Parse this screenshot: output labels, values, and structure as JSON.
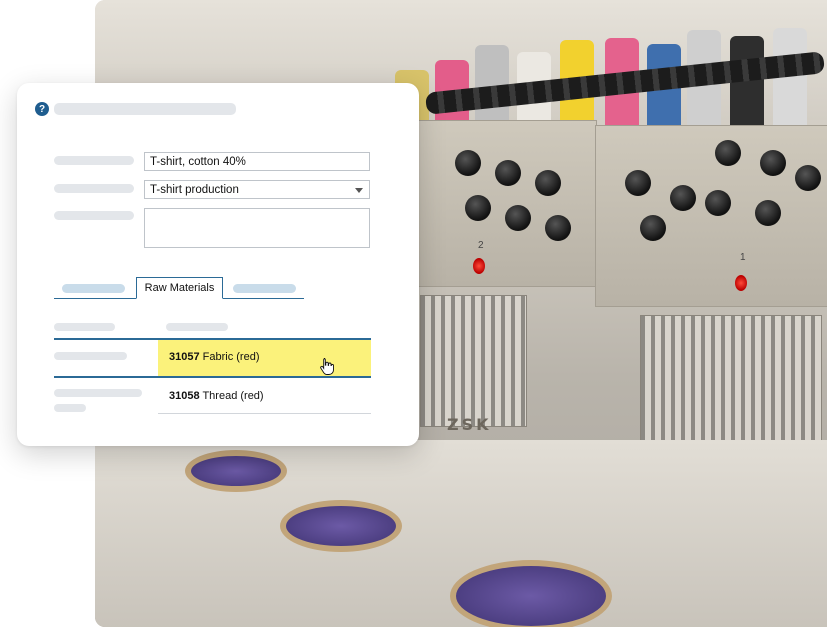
{
  "form": {
    "help_icon": "?",
    "name_value": "T-shirt, cotton 40%",
    "category_value": "T-shirt production",
    "notes_value": ""
  },
  "tabs": {
    "active_label": "Raw Materials"
  },
  "materials": [
    {
      "code": "31057",
      "name": "Fabric (red)",
      "highlighted": true
    },
    {
      "code": "31058",
      "name": "Thread (red)",
      "highlighted": false
    }
  ],
  "colors": {
    "accent": "#2b6a96",
    "highlight": "#fbf27b",
    "help_icon_bg": "#1f5d8f",
    "skeleton": "#e3e6ea"
  },
  "icons": [
    "help-icon",
    "dropdown-caret-icon",
    "hand-pointer-icon"
  ],
  "photo": {
    "machine_brand": "ZSK",
    "head_numbers": [
      "2",
      "1"
    ]
  }
}
